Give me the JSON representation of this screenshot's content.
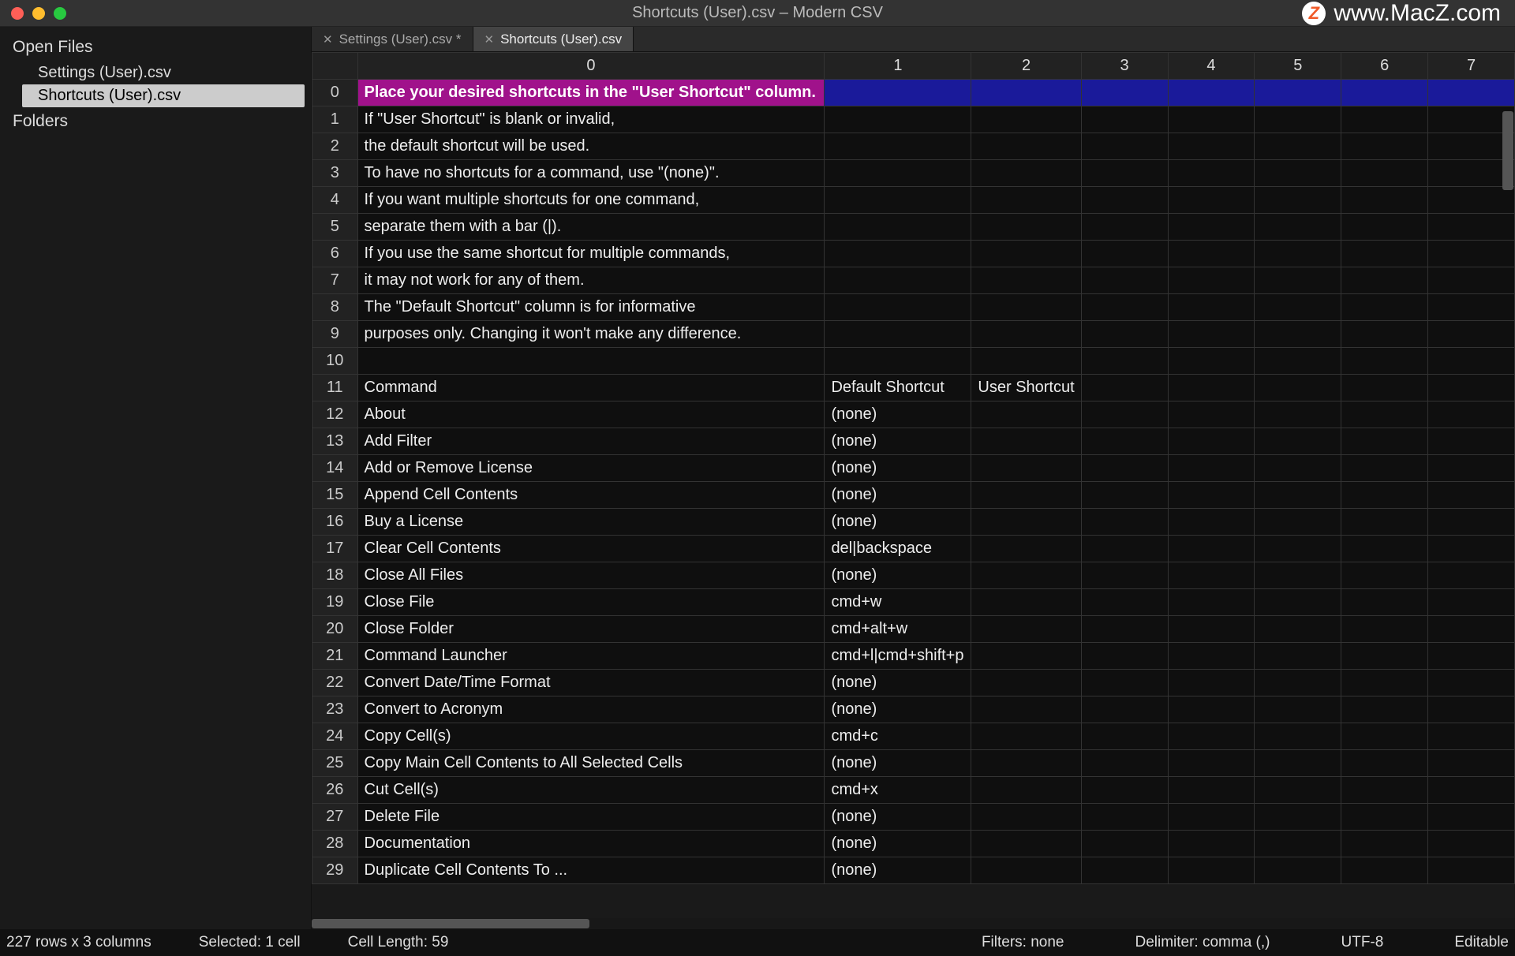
{
  "titlebar": {
    "title": "Shortcuts (User).csv – Modern CSV"
  },
  "watermark": {
    "text": "www.MacZ.com",
    "icon_letter": "Z"
  },
  "sidebar": {
    "open_files_label": "Open Files",
    "files": [
      {
        "name": "Settings (User).csv",
        "active": false
      },
      {
        "name": "Shortcuts (User).csv",
        "active": true
      }
    ],
    "folders_label": "Folders"
  },
  "tabs": [
    {
      "label": "Settings (User).csv *",
      "active": false
    },
    {
      "label": "Shortcuts (User).csv",
      "active": true
    }
  ],
  "columns": [
    "0",
    "1",
    "2",
    "3",
    "4",
    "5",
    "6",
    "7"
  ],
  "rows": [
    {
      "n": "0",
      "c0": "Place your desired shortcuts in the \"User Shortcut\" column.",
      "c1": "",
      "c2": "",
      "selected": true,
      "blueRow": true
    },
    {
      "n": "1",
      "c0": "If \"User Shortcut\" is blank or invalid,",
      "c1": "",
      "c2": ""
    },
    {
      "n": "2",
      "c0": "the default shortcut will be used.",
      "c1": "",
      "c2": ""
    },
    {
      "n": "3",
      "c0": "To have no shortcuts for a command, use \"(none)\".",
      "c1": "",
      "c2": ""
    },
    {
      "n": "4",
      "c0": "If you want multiple shortcuts for one command,",
      "c1": "",
      "c2": ""
    },
    {
      "n": "5",
      "c0": "separate them with a bar (|).",
      "c1": "",
      "c2": ""
    },
    {
      "n": "6",
      "c0": "If you use the same shortcut for multiple commands,",
      "c1": "",
      "c2": ""
    },
    {
      "n": "7",
      "c0": "it may not work for any of them.",
      "c1": "",
      "c2": ""
    },
    {
      "n": "8",
      "c0": "The \"Default Shortcut\" column is for informative",
      "c1": "",
      "c2": ""
    },
    {
      "n": "9",
      "c0": "purposes only. Changing it won't make any difference.",
      "c1": "",
      "c2": ""
    },
    {
      "n": "10",
      "c0": "",
      "c1": "",
      "c2": ""
    },
    {
      "n": "11",
      "c0": "Command",
      "c1": "Default Shortcut",
      "c2": "User Shortcut"
    },
    {
      "n": "12",
      "c0": "About",
      "c1": "(none)",
      "c2": ""
    },
    {
      "n": "13",
      "c0": "Add Filter",
      "c1": "(none)",
      "c2": ""
    },
    {
      "n": "14",
      "c0": "Add or Remove License",
      "c1": "(none)",
      "c2": ""
    },
    {
      "n": "15",
      "c0": "Append Cell Contents",
      "c1": "(none)",
      "c2": ""
    },
    {
      "n": "16",
      "c0": "Buy a License",
      "c1": "(none)",
      "c2": ""
    },
    {
      "n": "17",
      "c0": "Clear Cell Contents",
      "c1": "del|backspace",
      "c2": ""
    },
    {
      "n": "18",
      "c0": "Close All Files",
      "c1": "(none)",
      "c2": ""
    },
    {
      "n": "19",
      "c0": "Close File",
      "c1": "cmd+w",
      "c2": ""
    },
    {
      "n": "20",
      "c0": "Close Folder",
      "c1": "cmd+alt+w",
      "c2": ""
    },
    {
      "n": "21",
      "c0": "Command Launcher",
      "c1": "cmd+l|cmd+shift+p",
      "c2": ""
    },
    {
      "n": "22",
      "c0": "Convert Date/Time Format",
      "c1": "(none)",
      "c2": ""
    },
    {
      "n": "23",
      "c0": "Convert to Acronym",
      "c1": "(none)",
      "c2": ""
    },
    {
      "n": "24",
      "c0": "Copy Cell(s)",
      "c1": "cmd+c",
      "c2": ""
    },
    {
      "n": "25",
      "c0": "Copy Main Cell Contents to All Selected Cells",
      "c1": "(none)",
      "c2": ""
    },
    {
      "n": "26",
      "c0": "Cut Cell(s)",
      "c1": "cmd+x",
      "c2": ""
    },
    {
      "n": "27",
      "c0": "Delete File",
      "c1": "(none)",
      "c2": ""
    },
    {
      "n": "28",
      "c0": "Documentation",
      "c1": "(none)",
      "c2": ""
    },
    {
      "n": "29",
      "c0": "Duplicate Cell Contents To ...",
      "c1": "(none)",
      "c2": ""
    }
  ],
  "status": {
    "dims": "227 rows x 3 columns",
    "selected": "Selected: 1 cell",
    "cell_length": "Cell Length: 59",
    "filters": "Filters: none",
    "delimiter": "Delimiter: comma (,)",
    "encoding": "UTF-8",
    "editable": "Editable"
  }
}
